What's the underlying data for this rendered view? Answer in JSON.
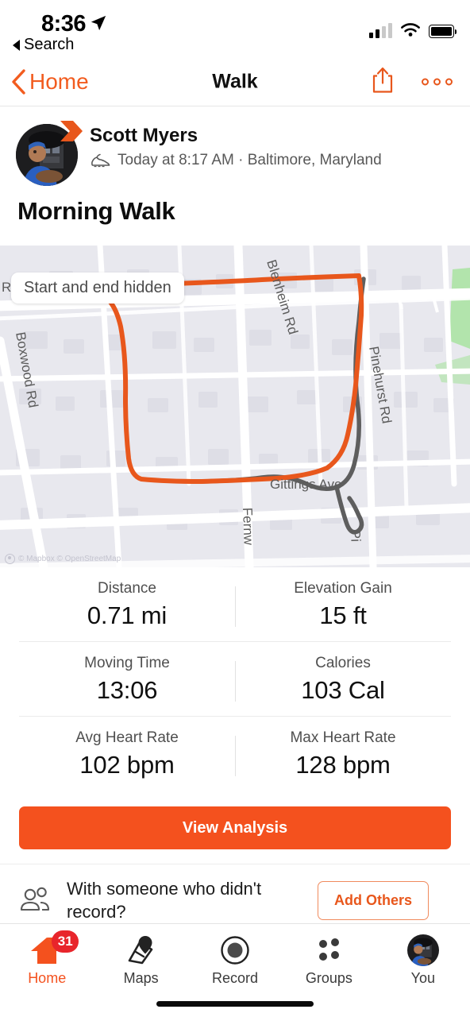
{
  "status_bar": {
    "time": "8:36",
    "back_app_label": "Search",
    "location_icon": "location-arrow-icon",
    "signal_icon": "cellular-signal-icon",
    "wifi_icon": "wifi-icon",
    "battery_icon": "battery-icon"
  },
  "nav_bar": {
    "back_label": "Home",
    "title": "Walk",
    "share_icon": "share-icon",
    "more_icon": "more-options-icon"
  },
  "athlete": {
    "name": "Scott Myers",
    "activity_type_icon": "shoe-icon",
    "meta": "Today at 8:17 AM · Baltimore, Maryland",
    "badge_icon": "chevron-badge-icon"
  },
  "activity": {
    "title": "Morning Walk"
  },
  "map": {
    "privacy_pill": "Start and end hidden",
    "attribution": "© Mapbox © OpenStreetMap",
    "street_labels": [
      "Rd",
      "Boxwood Rd",
      "Blenheim Rd",
      "Pinehurst Rd",
      "Gittings Ave",
      "Fernw",
      "Pi"
    ],
    "route_color": "#E8571C",
    "hidden_route_color": "#5e5e5e",
    "background_color": "#e8e8ee"
  },
  "stats": {
    "rows": [
      [
        {
          "label": "Distance",
          "value": "0.71 mi"
        },
        {
          "label": "Elevation Gain",
          "value": "15 ft"
        }
      ],
      [
        {
          "label": "Moving Time",
          "value": "13:06"
        },
        {
          "label": "Calories",
          "value": "103 Cal"
        }
      ],
      [
        {
          "label": "Avg Heart Rate",
          "value": "102 bpm"
        },
        {
          "label": "Max Heart Rate",
          "value": "128 bpm"
        }
      ]
    ]
  },
  "analysis": {
    "button_label": "View Analysis",
    "button_color": "#F4511E"
  },
  "add_others": {
    "prompt": "With someone who didn't record?",
    "button_label": "Add Others",
    "icon": "people-icon"
  },
  "tab_bar": {
    "items": [
      {
        "label": "Home",
        "icon": "home-icon",
        "badge": "31",
        "active": true
      },
      {
        "label": "Maps",
        "icon": "maps-icon",
        "badge": "",
        "active": false
      },
      {
        "label": "Record",
        "icon": "record-icon",
        "badge": "",
        "active": false
      },
      {
        "label": "Groups",
        "icon": "groups-icon",
        "badge": "",
        "active": false
      },
      {
        "label": "You",
        "icon": "profile-avatar-icon",
        "badge": "",
        "active": false
      }
    ],
    "active_color": "#F4511E",
    "badge_color": "#E8252B"
  }
}
